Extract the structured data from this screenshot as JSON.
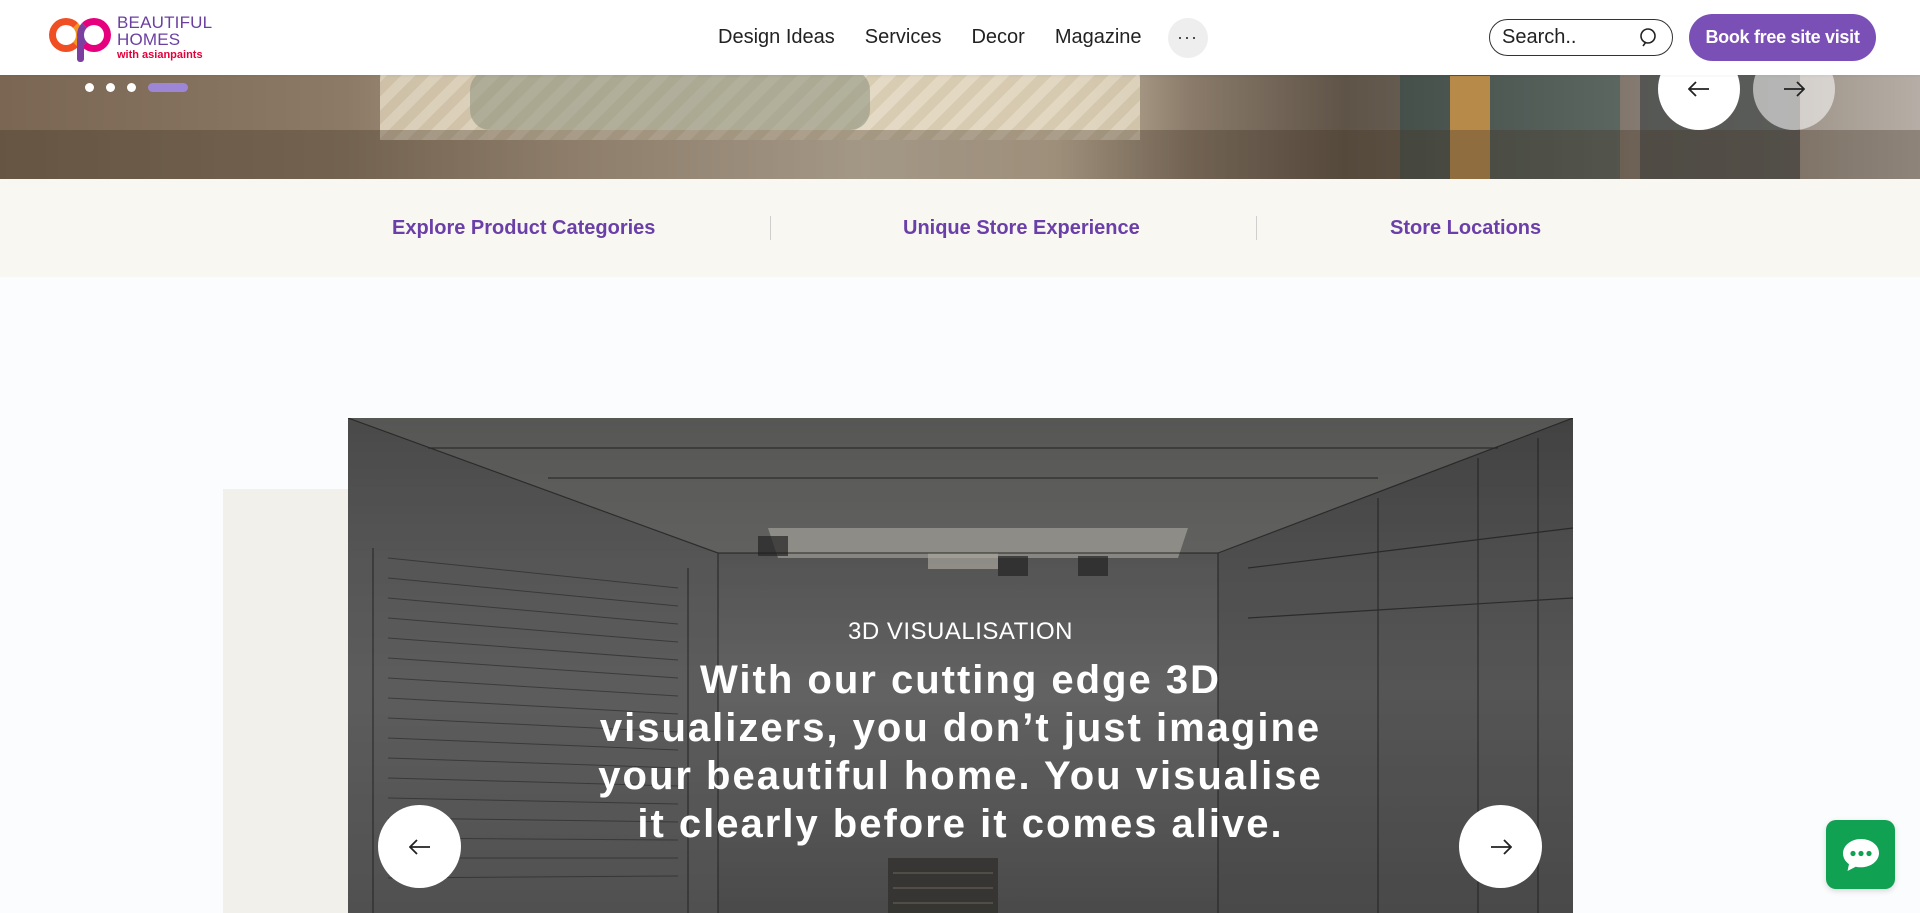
{
  "header": {
    "logo": {
      "line1": "BEAUTIFUL",
      "line2": "HOMES",
      "line3": "with asianpaints"
    },
    "nav": [
      "Design Ideas",
      "Services",
      "Decor",
      "Magazine"
    ],
    "more_label": "···",
    "search": {
      "placeholder": "Search.."
    },
    "cta_label": "Book free site visit"
  },
  "hero": {
    "slide_count": 4,
    "active_slide": 4
  },
  "quick_links": [
    "Explore Product Categories",
    "Unique Store Experience",
    "Store Locations"
  ],
  "visualisation": {
    "eyebrow": "3D VISUALISATION",
    "headline": "With our cutting edge 3D visualizers, you don’t just imagine your beautiful home. You visualise it clearly before it comes alive."
  },
  "icons": {
    "prev": "arrow-left-icon",
    "next": "arrow-right-icon",
    "search": "search-icon",
    "chat": "chat-icon"
  },
  "colors": {
    "brand_purple": "#7a4fb6",
    "link_purple": "#6a3fa8",
    "chat_green": "#11a153",
    "active_dot": "#9d86d6"
  }
}
